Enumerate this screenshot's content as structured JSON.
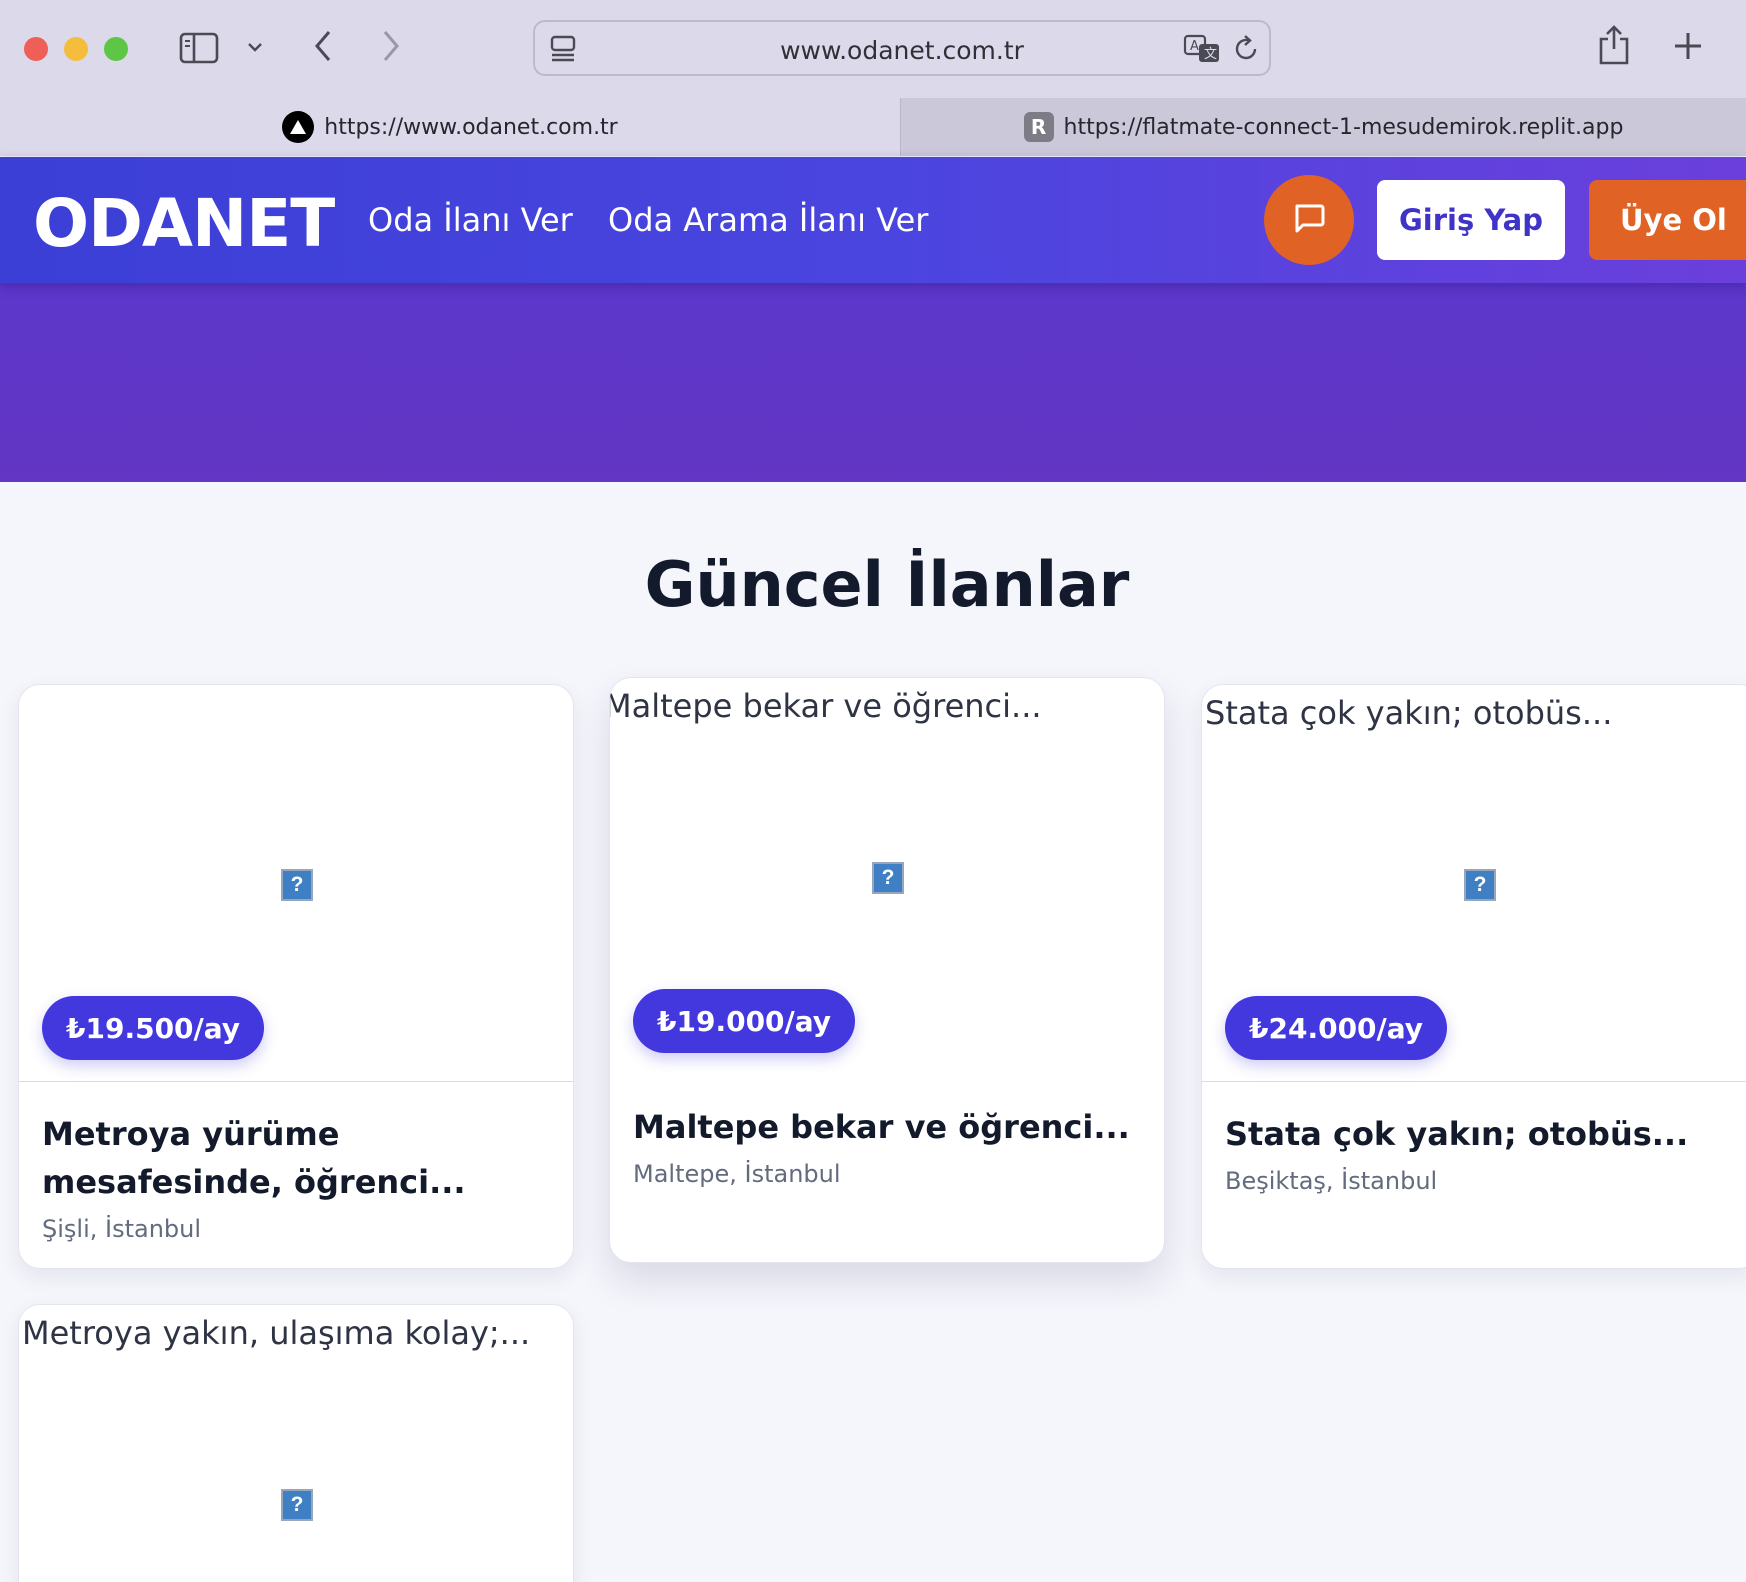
{
  "browser": {
    "url": "www.odanet.com.tr",
    "tabs": [
      {
        "label": "https://www.odanet.com.tr",
        "favicon": "triangle-logo-icon",
        "active": true
      },
      {
        "label": "https://flatmate-connect-1-mesudemirok.replit.app",
        "favicon_letter": "R",
        "active": false
      }
    ]
  },
  "header": {
    "logo": "ODANET",
    "nav": [
      "Oda İlanı Ver",
      "Oda Arama İlanı Ver"
    ],
    "login_label": "Giriş Yap",
    "signup_label": "Üye Ol"
  },
  "listings": {
    "title": "Güncel İlanlar",
    "cards": [
      {
        "alt": "",
        "price": "₺19.500/ay",
        "title": "Metroya yürüme mesafesinde, öğrenci...",
        "location": "Şişli, İstanbul"
      },
      {
        "alt": "Maltepe bekar ve öğrenci...",
        "price": "₺19.000/ay",
        "title": "Maltepe bekar ve öğrenci...",
        "location": "Maltepe, İstanbul"
      },
      {
        "alt": "Stata çok yakın; otobüs...",
        "price": "₺24.000/ay",
        "title": "Stata çok yakın; otobüs...",
        "location": "Beşiktaş, İstanbul"
      },
      {
        "alt": "Metroya yakın, ulaşıma kolay;..."
      }
    ]
  },
  "colors": {
    "brand_primary": "#4338dd",
    "brand_accent": "#e06224",
    "header_gradient_start": "#3b3fd6",
    "header_gradient_end": "#6b3fdc"
  }
}
